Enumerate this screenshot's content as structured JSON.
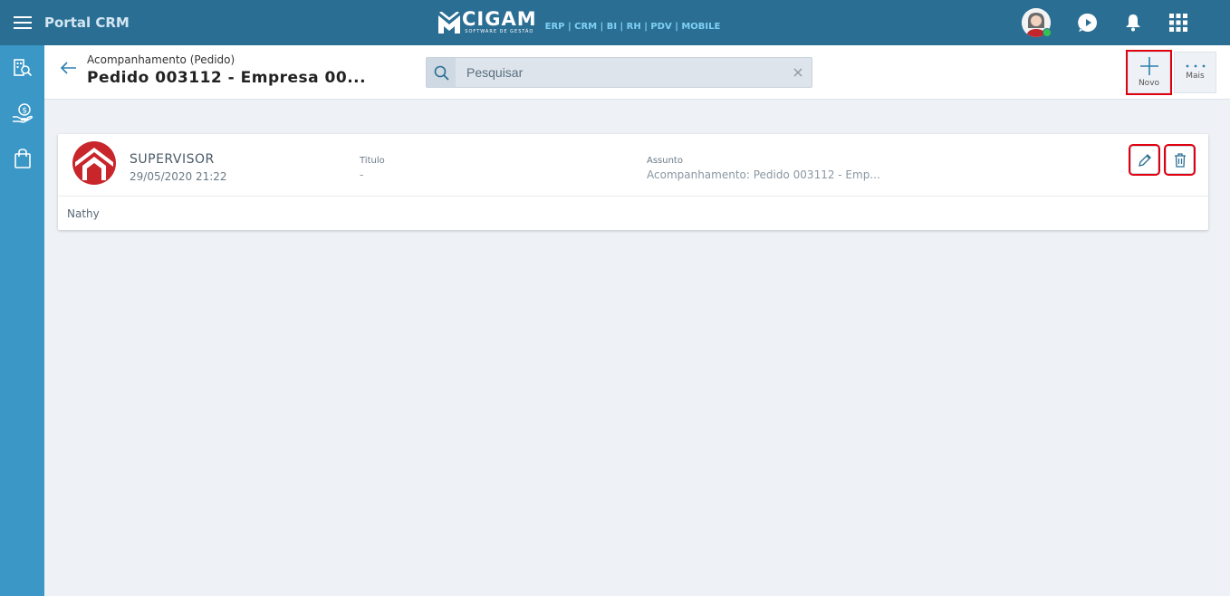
{
  "app": {
    "title": "Portal CRM"
  },
  "brand": {
    "word": "CIGAM",
    "tagline": "SOFTWARE DE GESTÃO",
    "products": "ERP | CRM | BI | RH | PDV | MOBILE"
  },
  "topbar_icons": [
    "menu-icon",
    "avatar",
    "play-circle-icon",
    "bell-icon",
    "apps-grid-icon"
  ],
  "sidebar": {
    "items": [
      {
        "icon": "building-search-icon"
      },
      {
        "icon": "hand-money-icon"
      },
      {
        "icon": "shopping-bag-icon"
      }
    ]
  },
  "header": {
    "breadcrumb": "Acompanhamento (Pedido)",
    "title": "Pedido 003112 - Empresa 00...",
    "search_placeholder": "Pesquisar",
    "new_label": "Novo",
    "more_label": "Mais"
  },
  "record": {
    "user": "SUPERVISOR",
    "datetime": "29/05/2020 21:22",
    "titulo_label": "Titulo",
    "titulo_value": "-",
    "assunto_label": "Assunto",
    "assunto_value": "Acompanhamento: Pedido 003112 - Emp...",
    "note": "Nathy"
  },
  "colors": {
    "topbar": "#2b6e93",
    "sidebar": "#3a97c6",
    "highlight": "#e00010",
    "logo_red": "#c8262b"
  }
}
